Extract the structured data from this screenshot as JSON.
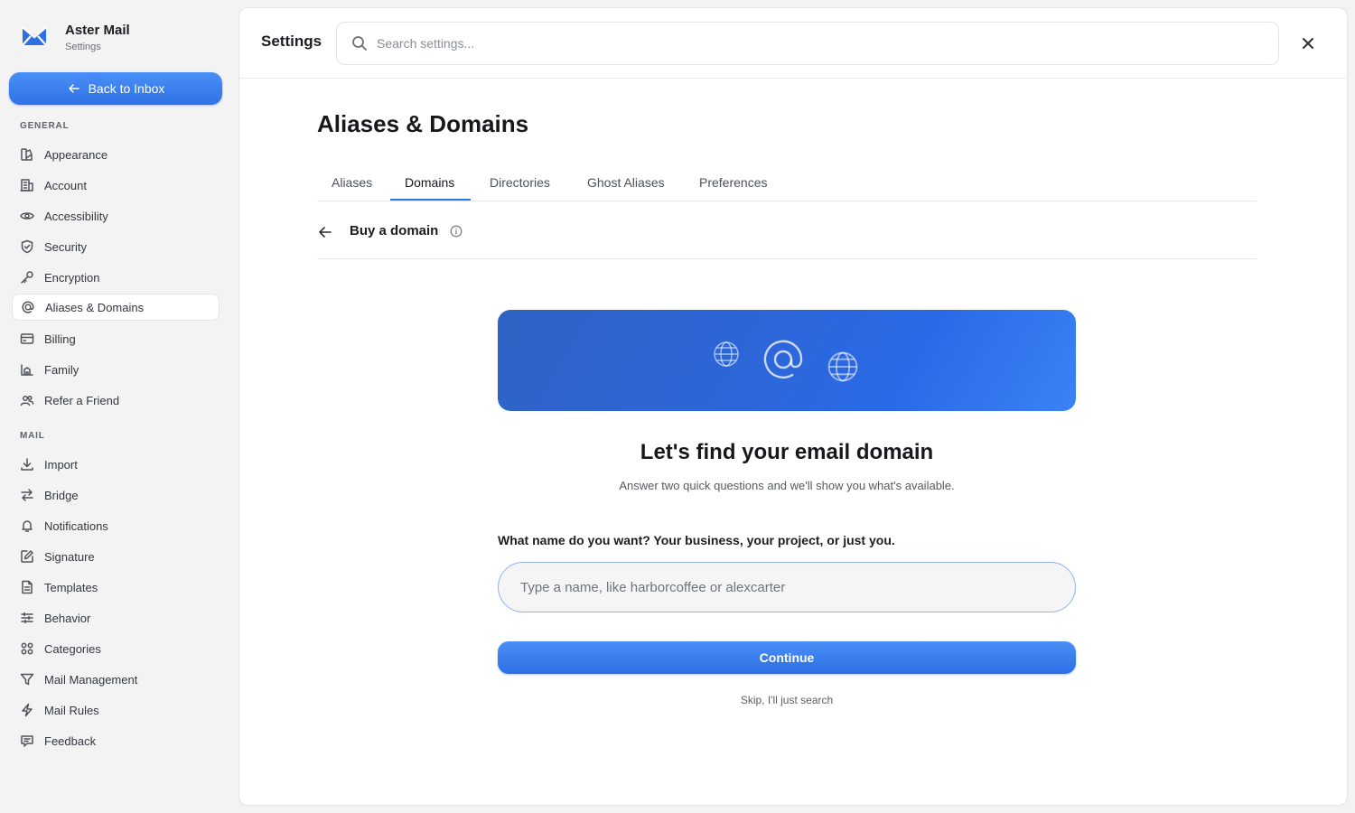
{
  "brand": {
    "name": "Aster Mail",
    "subtitle": "Settings"
  },
  "sidebar": {
    "back_label": "Back to Inbox",
    "general_label": "GENERAL",
    "mail_label": "MAIL",
    "general_items": [
      {
        "label": "Appearance",
        "icon": "palette-icon"
      },
      {
        "label": "Account",
        "icon": "building-icon"
      },
      {
        "label": "Accessibility",
        "icon": "eye-icon"
      },
      {
        "label": "Security",
        "icon": "shield-icon"
      },
      {
        "label": "Encryption",
        "icon": "key-icon"
      },
      {
        "label": "Aliases & Domains",
        "icon": "at-sign-icon",
        "active": true
      },
      {
        "label": "Billing",
        "icon": "credit-card-icon"
      },
      {
        "label": "Family",
        "icon": "family-icon"
      },
      {
        "label": "Refer a Friend",
        "icon": "users-icon"
      }
    ],
    "mail_items": [
      {
        "label": "Import",
        "icon": "download-icon"
      },
      {
        "label": "Bridge",
        "icon": "arrows-swap-icon"
      },
      {
        "label": "Notifications",
        "icon": "bell-icon"
      },
      {
        "label": "Signature",
        "icon": "pen-icon"
      },
      {
        "label": "Templates",
        "icon": "document-icon"
      },
      {
        "label": "Behavior",
        "icon": "sliders-icon"
      },
      {
        "label": "Categories",
        "icon": "grid-icon"
      },
      {
        "label": "Mail Management",
        "icon": "filter-icon"
      },
      {
        "label": "Mail Rules",
        "icon": "lightning-icon"
      },
      {
        "label": "Feedback",
        "icon": "message-icon"
      }
    ]
  },
  "header": {
    "title": "Settings",
    "search_placeholder": "Search settings..."
  },
  "page": {
    "title": "Aliases & Domains",
    "tabs": [
      "Aliases",
      "Domains",
      "Directories",
      "Ghost Aliases",
      "Preferences"
    ],
    "active_tab": "Domains",
    "subheader": "Buy a domain"
  },
  "wizard": {
    "heading": "Let's find your email domain",
    "subtext": "Answer two quick questions and we'll show you what's available.",
    "question": "What name do you want? Your business, your project, or just you.",
    "input_placeholder": "Type a name, like harborcoffee or alexcarter",
    "input_value": "",
    "continue_label": "Continue",
    "skip_label": "Skip, I'll just search"
  },
  "colors": {
    "accent": "#3076e8",
    "banner_start": "#2f63c4",
    "banner_end": "#3b82f6"
  }
}
